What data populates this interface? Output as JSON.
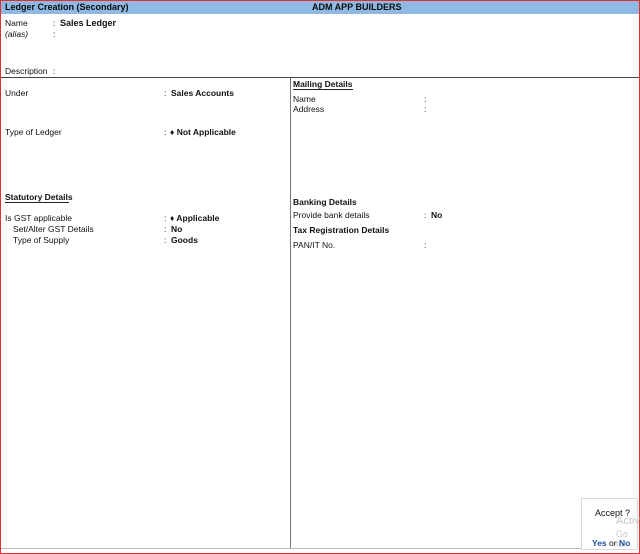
{
  "header": {
    "title": "Ledger Creation (Secondary)",
    "company": "ADM  APP BUILDERS"
  },
  "form": {
    "name_label": "Name",
    "name_value": "Sales Ledger",
    "alias_label": "(alias)",
    "description_label": "Description",
    "colon": ":",
    "under_label": "Under",
    "under_value": "Sales Accounts",
    "type_label": "Type of Ledger",
    "type_value": "♦ Not Applicable"
  },
  "statutory": {
    "heading": "Statutory Details",
    "gst_applicable_label": "Is GST applicable",
    "gst_applicable_value": "♦ Applicable",
    "set_alter_label": "Set/Alter GST Details",
    "set_alter_value": "No",
    "supply_label": "Type of Supply",
    "supply_value": "Goods"
  },
  "mailing": {
    "heading": "Mailing Details",
    "name_label": "Name",
    "address_label": "Address"
  },
  "banking": {
    "heading": "Banking Details",
    "provide_label": "Provide bank details",
    "provide_value": "No"
  },
  "tax": {
    "heading": "Tax Registration Details",
    "pan_label": "PAN/IT No."
  },
  "accept": {
    "question": "Accept ?",
    "yes": "Yes",
    "or": "or",
    "no": "No",
    "watermark_line1": "Activ",
    "watermark_line2": "Go to"
  },
  "colors": {
    "titlebar": "#8fb9e3",
    "frame": "#e03030",
    "link": "#1b4e9e"
  }
}
